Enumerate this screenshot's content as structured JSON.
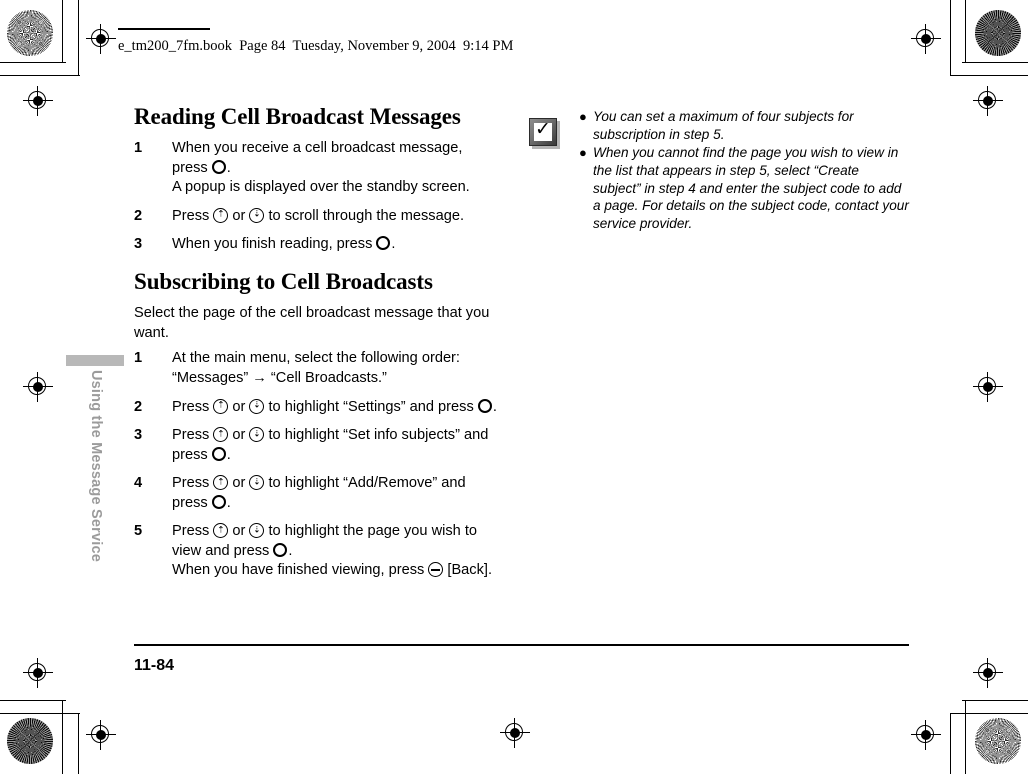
{
  "header": {
    "file_line": "e_tm200_7fm.book  Page 84  Tuesday, November 9, 2004  9:14 PM"
  },
  "side_tab": {
    "label": "Using the Message Service"
  },
  "sections": [
    {
      "title": "Reading Cell Broadcast Messages",
      "steps": [
        {
          "num": "1",
          "text_before": "When you receive a cell broadcast message, press ",
          "key": "select-key-icon",
          "text_after": ".",
          "subtext": "A popup is displayed over the standby screen."
        },
        {
          "num": "2",
          "text_before": "Press ",
          "key_up": "up-key-icon",
          "text_mid": " or ",
          "key_down": "down-key-icon",
          "text_after": " to scroll through the message."
        },
        {
          "num": "3",
          "text_before": "When you finish reading, press ",
          "key": "select-key-icon",
          "text_after": "."
        }
      ]
    },
    {
      "title": "Subscribing to Cell Broadcasts",
      "lead": "Select the page of the cell broadcast message that you want.",
      "steps": [
        {
          "num": "1",
          "text_before": "At the main menu, select the following order: “Messages” → “Cell Broadcasts.”"
        },
        {
          "num": "2",
          "text_before": "Press ",
          "key_up": "up-key-icon",
          "text_mid": " or ",
          "key_down": "down-key-icon",
          "text_after2": " to highlight “Settings” and press ",
          "key": "select-key-icon",
          "text_after": "."
        },
        {
          "num": "3",
          "text_before": "Press ",
          "key_up": "up-key-icon",
          "text_mid": " or ",
          "key_down": "down-key-icon",
          "text_after2": " to highlight “Set info subjects” and press ",
          "key": "select-key-icon",
          "text_after": "."
        },
        {
          "num": "4",
          "text_before": "Press ",
          "key_up": "up-key-icon",
          "text_mid": " or ",
          "key_down": "down-key-icon",
          "text_after2": " to highlight “Add/Remove” and press ",
          "key": "select-key-icon",
          "text_after": "."
        },
        {
          "num": "5",
          "text_before": "Press ",
          "key_up": "up-key-icon",
          "text_mid": " or ",
          "key_down": "down-key-icon",
          "text_after2": " to highlight the page you wish to view and press ",
          "key": "select-key-icon",
          "text_after": ".",
          "sub_before": "When you have finished viewing, press ",
          "sub_key": "back-key-icon",
          "sub_after": " [Back]."
        }
      ]
    }
  ],
  "note": {
    "icon": "note-check-icon",
    "items": [
      "You can set a maximum of four subjects for subscription in step 5.",
      "When you cannot find the page you wish to view in the list that appears in step 5, select “Create subject” in step 4 and enter the subject code to add a page. For details on the subject code, contact your service provider."
    ],
    "bullet_glyph": "●"
  },
  "footer": {
    "page_number": "11-84"
  },
  "glyphs": {
    "up_arrow": "⇡",
    "down_arrow": "⇣",
    "check": "✓"
  },
  "colors": {
    "tab_gray": "#b8b8b8",
    "tab_text_gray": "#9b9b9b",
    "ink": "#000000",
    "page": "#ffffff"
  }
}
